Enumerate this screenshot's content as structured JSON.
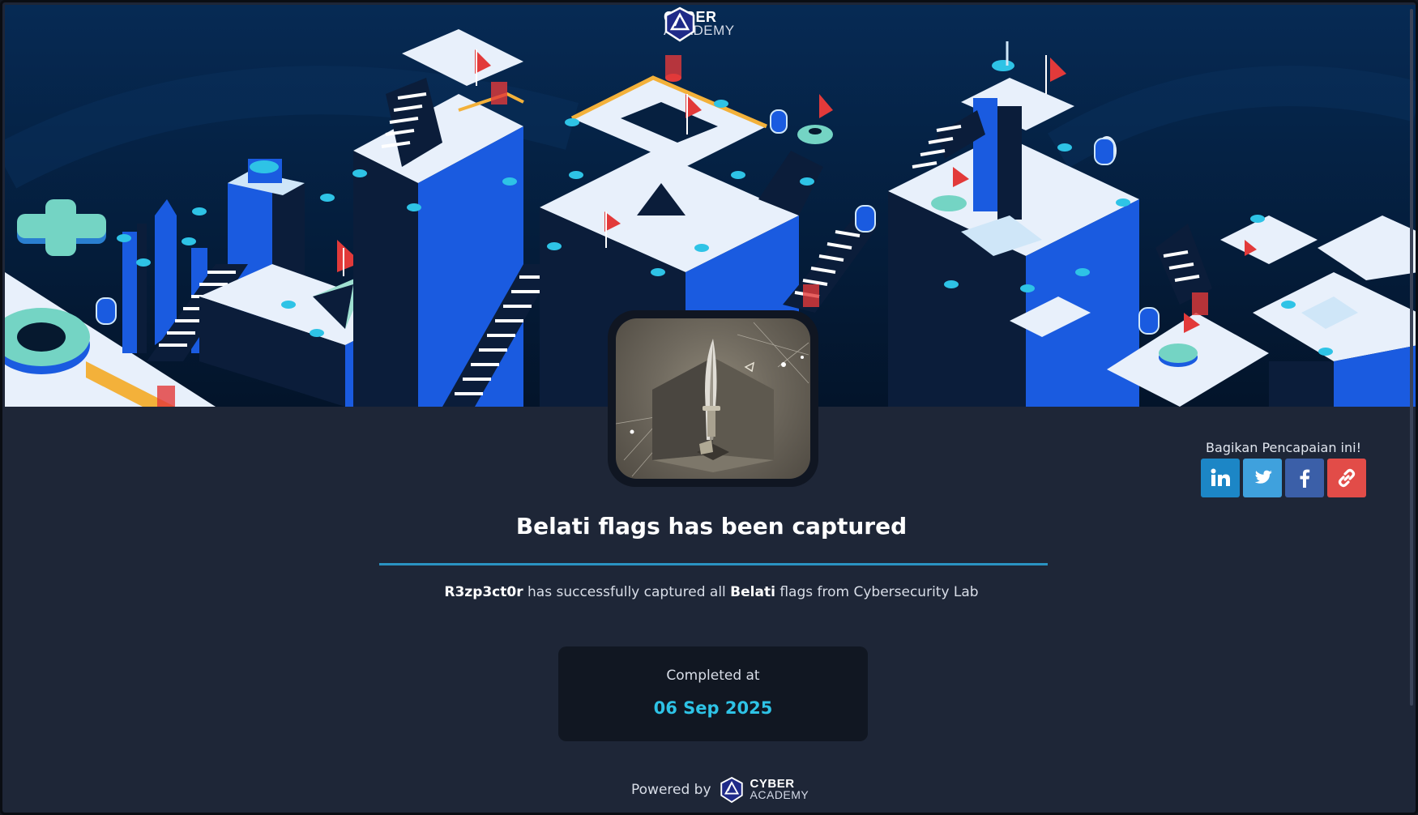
{
  "brand": {
    "line1": "CYBER",
    "line2": "ACADEMY"
  },
  "share": {
    "label": "Bagikan Pencapaian ini!",
    "buttons": [
      {
        "name": "linkedin",
        "icon": "linkedin-icon",
        "color": "#1c86c6"
      },
      {
        "name": "twitter",
        "icon": "twitter-icon",
        "color": "#3fa1dd"
      },
      {
        "name": "facebook",
        "icon": "facebook-icon",
        "color": "#3b5fa8"
      },
      {
        "name": "copy-link",
        "icon": "link-icon",
        "color": "#e24c48"
      }
    ]
  },
  "badge": {
    "icon": "dagger-icon"
  },
  "achievement": {
    "title": "Belati flags has been captured",
    "user": "R3zp3ct0r",
    "text_1": "has successfully captured all",
    "flag_name": "Belati",
    "text_2": "flags from Cybersecurity Lab"
  },
  "completed": {
    "label": "Completed at",
    "date": "06 Sep 2025"
  },
  "footer": {
    "powered_by": "Powered by"
  },
  "colors": {
    "accent": "#2ec3e6",
    "divider": "#2a93c2",
    "background": "#1e2637",
    "banner_blue": "#1a5be0"
  }
}
